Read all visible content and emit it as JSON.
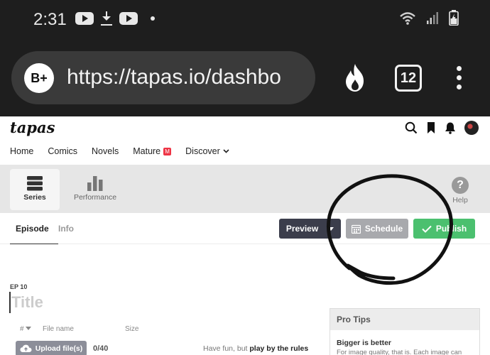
{
  "status_bar": {
    "time": "2:31"
  },
  "browser": {
    "site_badge": "B+",
    "url": "https://tapas.io/dashbo",
    "tab_count": "12"
  },
  "header": {
    "logo": "tapas",
    "nav": [
      "Home",
      "Comics",
      "Novels",
      "Mature",
      "Discover"
    ],
    "mature_badge": "M"
  },
  "toolbar": {
    "series_label": "Series",
    "performance_label": "Performance",
    "help_label": "Help",
    "help_glyph": "?"
  },
  "tabs": {
    "episode": "Episode",
    "info": "Info"
  },
  "actions": {
    "preview": "Preview",
    "schedule": "Schedule",
    "publish": "Publish"
  },
  "editor": {
    "episode_label": "EP 10",
    "title_placeholder": "Title",
    "columns": {
      "number": "#",
      "file_name": "File name",
      "size": "Size"
    },
    "upload_label": "Upload file(s)",
    "upload_count": "0/40",
    "rules_prefix": "Have fun, but ",
    "rules_link": "play by the rules"
  },
  "pro_tips": {
    "heading": "Pro Tips",
    "subheading": "Bigger is better",
    "body": "For image quality, that is. Each image can"
  },
  "colors": {
    "preview_btn": "#3b3d4b",
    "schedule_btn": "#a8a9ad",
    "publish_btn": "#4bc06f",
    "chrome_bg": "#1e1e1e"
  }
}
